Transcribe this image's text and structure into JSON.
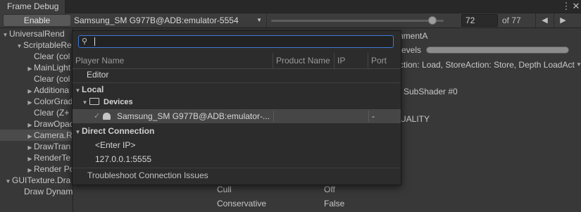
{
  "window": {
    "title": "Frame Debug",
    "menu_icon": "kebab-menu-icon"
  },
  "toolbar": {
    "enable_label": "Enable",
    "player_selected": "Samsung_SM G977B@ADB:emulator-5554",
    "frame_value": "72",
    "frame_total": "of 77",
    "frame_fraction": 0.935
  },
  "tree": {
    "items": [
      {
        "label": "UniversalRend",
        "arrow": "▼"
      },
      {
        "label": "ScriptableRe",
        "arrow": "▼"
      },
      {
        "label": "Clear (col",
        "arrow": ""
      },
      {
        "label": "MainLight",
        "arrow": "▶"
      },
      {
        "label": "Clear (col",
        "arrow": ""
      },
      {
        "label": "Additiona",
        "arrow": "▶"
      },
      {
        "label": "ColorGrad",
        "arrow": "▶"
      },
      {
        "label": "Clear (Z+",
        "arrow": ""
      },
      {
        "label": "DrawOpaq",
        "arrow": "▶"
      },
      {
        "label": "Camera.R",
        "arrow": "▶"
      },
      {
        "label": "DrawTran",
        "arrow": "▶"
      },
      {
        "label": "RenderTe",
        "arrow": "▶"
      },
      {
        "label": "Render Po",
        "arrow": "▶"
      },
      {
        "label": "GUITexture.Dra",
        "arrow": "▼"
      },
      {
        "label": "Draw Dynamic",
        "arrow": ""
      }
    ]
  },
  "detail": {
    "attachment": "hmentA",
    "levels_label": "evels",
    "action": "ction: Load, StoreAction: Store, Depth LoadAct",
    "subshader": "SubShader #0",
    "quality": "UALITY",
    "props": [
      {
        "name": "Cull",
        "value": "Off"
      },
      {
        "name": "Conservative",
        "value": "False"
      }
    ]
  },
  "popup": {
    "search_placeholder": "",
    "columns": [
      "Player Name",
      "Product Name",
      "IP",
      "Port"
    ],
    "editor_label": "Editor",
    "local_label": "Local",
    "devices_label": "Devices",
    "device_name": "Samsung_SM G977B@ADB:emulator-...",
    "device_port": "-",
    "direct_label": "Direct Connection",
    "enter_ip": "<Enter IP>",
    "ip_entry": "127.0.0.1:5555",
    "troubleshoot": "Troubleshoot Connection Issues"
  }
}
